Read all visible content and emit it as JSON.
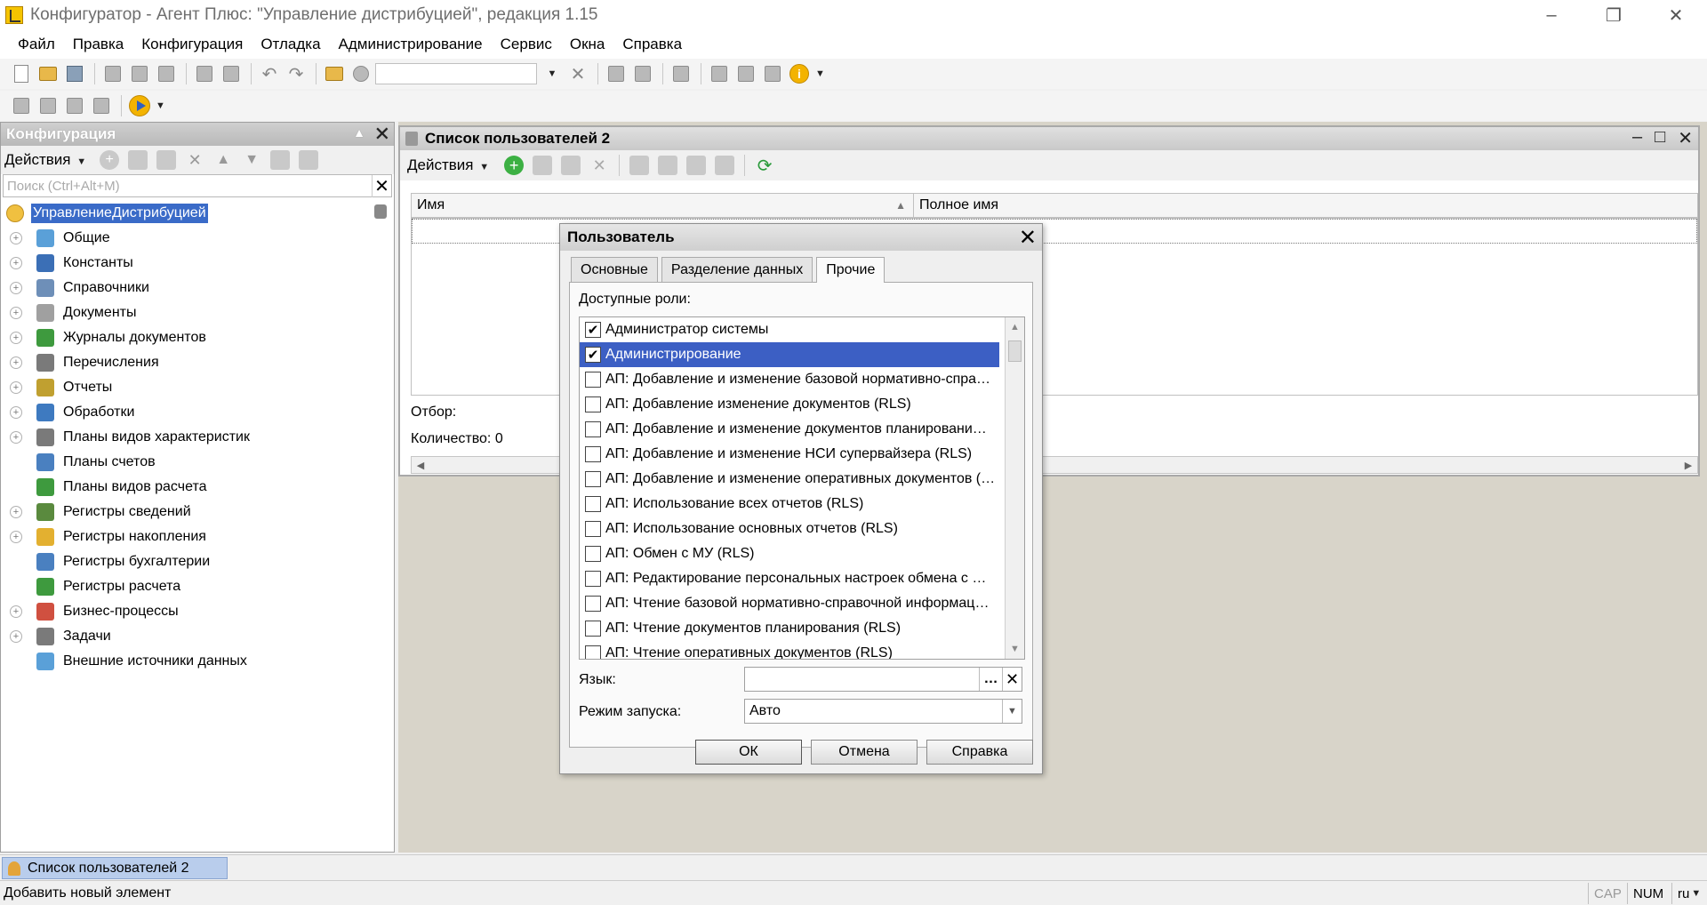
{
  "window": {
    "title": "Конфигуратор - Агент Плюс: \"Управление дистрибуцией\", редакция 1.15"
  },
  "menu": [
    {
      "label": "Файл"
    },
    {
      "label": "Правка"
    },
    {
      "label": "Конфигурация"
    },
    {
      "label": "Отладка"
    },
    {
      "label": "Администрирование"
    },
    {
      "label": "Сервис"
    },
    {
      "label": "Окна"
    },
    {
      "label": "Справка"
    }
  ],
  "left_panel": {
    "title": "Конфигурация",
    "actions_label": "Действия",
    "search_placeholder": "Поиск (Ctrl+Alt+M)",
    "root": "УправлениеДистрибуцией",
    "items": [
      {
        "label": "Общие",
        "icon": "common-icon",
        "expandable": true
      },
      {
        "label": "Константы",
        "icon": "constants-icon",
        "expandable": true
      },
      {
        "label": "Справочники",
        "icon": "catalogs-icon",
        "expandable": true
      },
      {
        "label": "Документы",
        "icon": "documents-icon",
        "expandable": true
      },
      {
        "label": "Журналы документов",
        "icon": "journals-icon",
        "expandable": true
      },
      {
        "label": "Перечисления",
        "icon": "enums-icon",
        "expandable": true
      },
      {
        "label": "Отчеты",
        "icon": "reports-icon",
        "expandable": true
      },
      {
        "label": "Обработки",
        "icon": "processing-icon",
        "expandable": true
      },
      {
        "label": "Планы видов характеристик",
        "icon": "chart-char-icon",
        "expandable": true
      },
      {
        "label": "Планы счетов",
        "icon": "chart-accounts-icon",
        "expandable": false
      },
      {
        "label": "Планы видов расчета",
        "icon": "chart-calc-icon",
        "expandable": false
      },
      {
        "label": "Регистры сведений",
        "icon": "info-registers-icon",
        "expandable": true
      },
      {
        "label": "Регистры накопления",
        "icon": "accum-registers-icon",
        "expandable": true
      },
      {
        "label": "Регистры бухгалтерии",
        "icon": "acc-registers-icon",
        "expandable": false
      },
      {
        "label": "Регистры расчета",
        "icon": "calc-registers-icon",
        "expandable": false
      },
      {
        "label": "Бизнес-процессы",
        "icon": "business-process-icon",
        "expandable": true
      },
      {
        "label": "Задачи",
        "icon": "tasks-icon",
        "expandable": true
      },
      {
        "label": "Внешние источники данных",
        "icon": "external-data-icon",
        "expandable": false
      }
    ]
  },
  "user_list": {
    "title": "Список пользователей 2",
    "actions_label": "Действия",
    "columns": [
      "Имя",
      "Полное имя"
    ],
    "filter_label": "Отбор:",
    "count_label": "Количество: 0"
  },
  "dialog": {
    "title": "Пользователь",
    "tabs": [
      {
        "label": "Основные",
        "active": false
      },
      {
        "label": "Разделение данных",
        "active": false
      },
      {
        "label": "Прочие",
        "active": true
      }
    ],
    "roles_label": "Доступные роли:",
    "roles": [
      {
        "label": "Администратор системы",
        "checked": true,
        "selected": false
      },
      {
        "label": "Администрирование",
        "checked": true,
        "selected": true
      },
      {
        "label": "АП: Добавление и изменение базовой нормативно-спра…",
        "checked": false,
        "selected": false
      },
      {
        "label": "АП: Добавление изменение документов (RLS)",
        "checked": false,
        "selected": false
      },
      {
        "label": "АП: Добавление и изменение документов планировани…",
        "checked": false,
        "selected": false
      },
      {
        "label": "АП: Добавление и изменение НСИ супервайзера (RLS)",
        "checked": false,
        "selected": false
      },
      {
        "label": "АП: Добавление и изменение оперативных документов (…",
        "checked": false,
        "selected": false
      },
      {
        "label": "АП: Использование всех отчетов (RLS)",
        "checked": false,
        "selected": false
      },
      {
        "label": "АП: Использование основных отчетов (RLS)",
        "checked": false,
        "selected": false
      },
      {
        "label": "АП: Обмен с МУ (RLS)",
        "checked": false,
        "selected": false
      },
      {
        "label": "АП: Редактирование персональных настроек обмена с …",
        "checked": false,
        "selected": false
      },
      {
        "label": "АП: Чтение базовой нормативно-справочной информац…",
        "checked": false,
        "selected": false
      },
      {
        "label": "АП: Чтение документов планирования (RLS)",
        "checked": false,
        "selected": false
      },
      {
        "label": "АП: Чтение оперативных документов (RLS)",
        "checked": false,
        "selected": false
      }
    ],
    "language_label": "Язык:",
    "language_value": "",
    "launch_mode_label": "Режим запуска:",
    "launch_mode_value": "Авто",
    "ok_label": "ОК",
    "cancel_label": "Отмена",
    "help_label": "Справка"
  },
  "window_tabs": [
    {
      "label": "Список пользователей 2"
    }
  ],
  "status": {
    "message": "Добавить новый элемент",
    "cap": "CAP",
    "num": "NUM",
    "lang": "ru"
  }
}
